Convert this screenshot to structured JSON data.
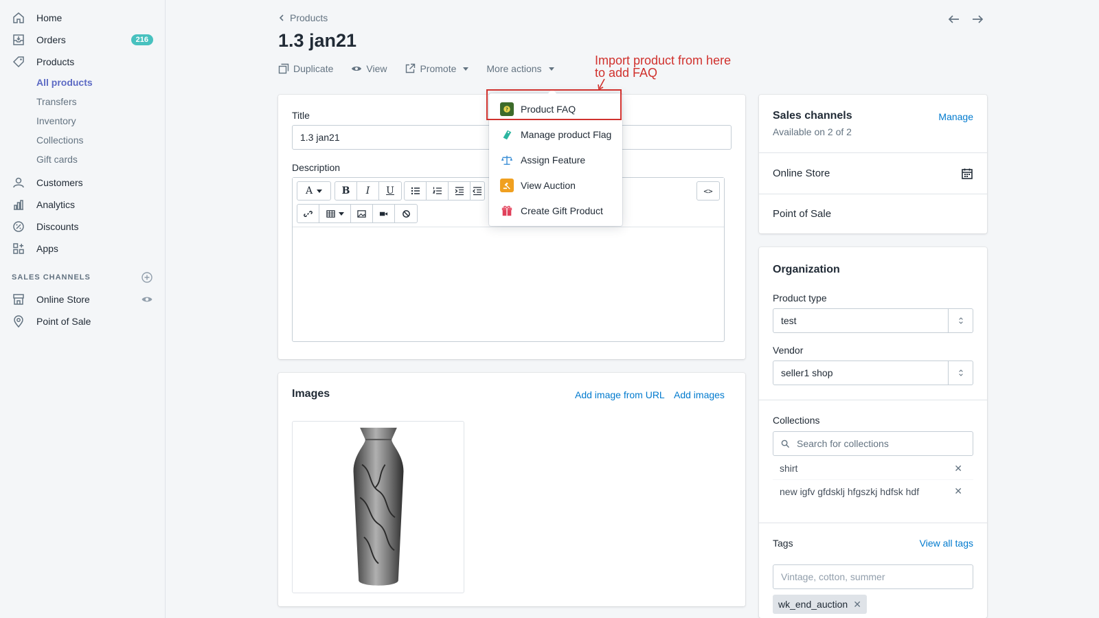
{
  "sidebar": {
    "items": [
      {
        "label": "Home",
        "icon": "home-icon"
      },
      {
        "label": "Orders",
        "icon": "orders-icon",
        "badge": "216"
      },
      {
        "label": "Products",
        "icon": "tag-icon"
      }
    ],
    "product_subitems": [
      "All products",
      "Transfers",
      "Inventory",
      "Collections",
      "Gift cards"
    ],
    "more_items": [
      {
        "label": "Customers",
        "icon": "person-icon"
      },
      {
        "label": "Analytics",
        "icon": "bar-chart-icon"
      },
      {
        "label": "Discounts",
        "icon": "discount-icon"
      },
      {
        "label": "Apps",
        "icon": "apps-icon"
      }
    ],
    "sales_channels_heading": "SALES CHANNELS",
    "channels": [
      {
        "label": "Online Store",
        "icon": "store-icon"
      },
      {
        "label": "Point of Sale",
        "icon": "location-icon"
      }
    ]
  },
  "header": {
    "breadcrumb": "Products",
    "title": "1.3 jan21",
    "actions": {
      "duplicate": "Duplicate",
      "view": "View",
      "promote": "Promote",
      "more": "More actions"
    }
  },
  "annotation": "Import product from here\nto add FAQ",
  "dropdown": [
    {
      "label": "Product FAQ",
      "icon": "faq-icon",
      "color": "#4a8a3a"
    },
    {
      "label": "Manage product Flag",
      "icon": "flag-icon",
      "color": "#2bb5a0"
    },
    {
      "label": "Assign Feature",
      "icon": "scale-icon",
      "color": "#3b8fd6"
    },
    {
      "label": "View Auction",
      "icon": "auction-icon",
      "color": "#f0a020"
    },
    {
      "label": "Create Gift Product",
      "icon": "gift-icon",
      "color": "#e0405a"
    }
  ],
  "form": {
    "title_label": "Title",
    "title_value": "1.3 jan21",
    "description_label": "Description"
  },
  "images": {
    "heading": "Images",
    "add_url": "Add image from URL",
    "add_images": "Add images"
  },
  "sales_channels": {
    "title": "Sales channels",
    "manage": "Manage",
    "available": "Available on 2 of 2",
    "channels": [
      "Online Store",
      "Point of Sale"
    ]
  },
  "organization": {
    "title": "Organization",
    "product_type_label": "Product type",
    "product_type_value": "test",
    "vendor_label": "Vendor",
    "vendor_value": "seller1 shop",
    "collections_label": "Collections",
    "collections_placeholder": "Search for collections",
    "collections": [
      "shirt",
      "new igfv gfdsklj hfgszkj hdfsk hdf"
    ]
  },
  "tags": {
    "title": "Tags",
    "view_all": "View all tags",
    "placeholder": "Vintage, cotton, summer",
    "chips": [
      "wk_end_auction"
    ]
  }
}
